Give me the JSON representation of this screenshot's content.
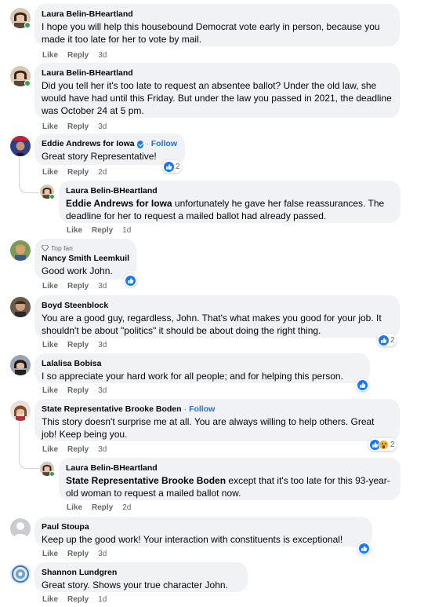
{
  "labels": {
    "like": "Like",
    "reply": "Reply",
    "follow": "Follow",
    "dot": "·"
  },
  "colors": {
    "bubble": "#f0f2f5",
    "link": "#216fdb",
    "meta": "#65676b",
    "like_blue": "#1877f2",
    "online": "#31a24c"
  },
  "comments": [
    {
      "author": "Laura Belin-BHeartland",
      "text": "I hope you will help this housebound Democrat vote early in person, because you made it too late for her to vote by mail.",
      "time": "3d"
    },
    {
      "author": "Laura Belin-BHeartland",
      "text": "Did you tell her it's too late to request an absentee ballot? Under the old law, she would have had until this Friday. But under the law you passed in 2021, the deadline was October 24 at 5 pm.",
      "time": "3d"
    },
    {
      "author": "Eddie Andrews for Iowa",
      "text": "Great story Representative!",
      "time": "2d",
      "reaction_count": "2"
    },
    {
      "author": "Laura Belin-BHeartland",
      "mention": "Eddie Andrews for Iowa",
      "text": " unfortunately he gave her false reassurances. The deadline for her to request a mailed ballot had already passed.",
      "time": "1d"
    },
    {
      "badge": "Top fan",
      "author": "Nancy Smith Leemkuil",
      "text": "Good work John.",
      "time": "3d"
    },
    {
      "author": "Boyd Steenblock",
      "text": "You are a good guy, regardless, John. That's what makes you good for your job. It shouldn't be about \"politics\" it should be about doing the right thing.",
      "time": "3d",
      "reaction_count": "2"
    },
    {
      "author": "Lalalisa Bobisa",
      "text": "I so appreciate your hard work for all people; and for helping this person.",
      "time": "3d"
    },
    {
      "author": "State Representative Brooke Boden",
      "text": "This story doesn't surprise me at all. You are always willing to help others. Great job! Keep being you.",
      "time": "3d",
      "reaction_count": "2"
    },
    {
      "author": "Laura Belin-BHeartland",
      "mention": "State Representative Brooke Boden",
      "text": " except that it's too late for this 93-year-old woman to request a mailed ballot now.",
      "time": "2d"
    },
    {
      "author": "Paul Stoupa",
      "text": "Keep up the good work! Your interaction with constituents is exceptional!",
      "time": "3d"
    },
    {
      "author": "Shannon Lundgren",
      "text": "Great story. Shows your true character John.",
      "time": "1d"
    }
  ]
}
